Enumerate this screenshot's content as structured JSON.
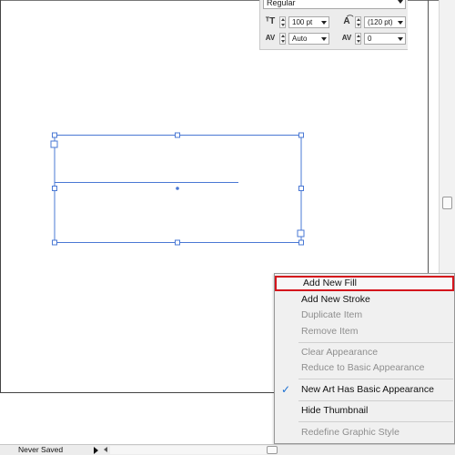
{
  "character_panel": {
    "font_style": "Regular",
    "font_size": "100 pt",
    "leading": "(120 pt)",
    "kerning": "Auto",
    "tracking": "0"
  },
  "appearance_menu": {
    "items": [
      {
        "label": "Add New Fill",
        "enabled": true,
        "highlighted": true
      },
      {
        "label": "Add New Stroke",
        "enabled": true
      },
      {
        "label": "Duplicate Item",
        "enabled": false
      },
      {
        "label": "Remove Item",
        "enabled": false
      },
      {
        "label": "Clear Appearance",
        "enabled": false
      },
      {
        "label": "Reduce to Basic Appearance",
        "enabled": false
      },
      {
        "label": "New Art Has Basic Appearance",
        "enabled": true,
        "checked": true
      },
      {
        "label": "Hide Thumbnail",
        "enabled": true
      },
      {
        "label": "Redefine Graphic Style",
        "enabled": false
      }
    ],
    "highlight_color": "#d4141c",
    "check_color": "#1a6fd1"
  },
  "status_bar": {
    "status": "Never Saved"
  },
  "selection": {
    "bounding_box_color": "#4a78d4"
  }
}
